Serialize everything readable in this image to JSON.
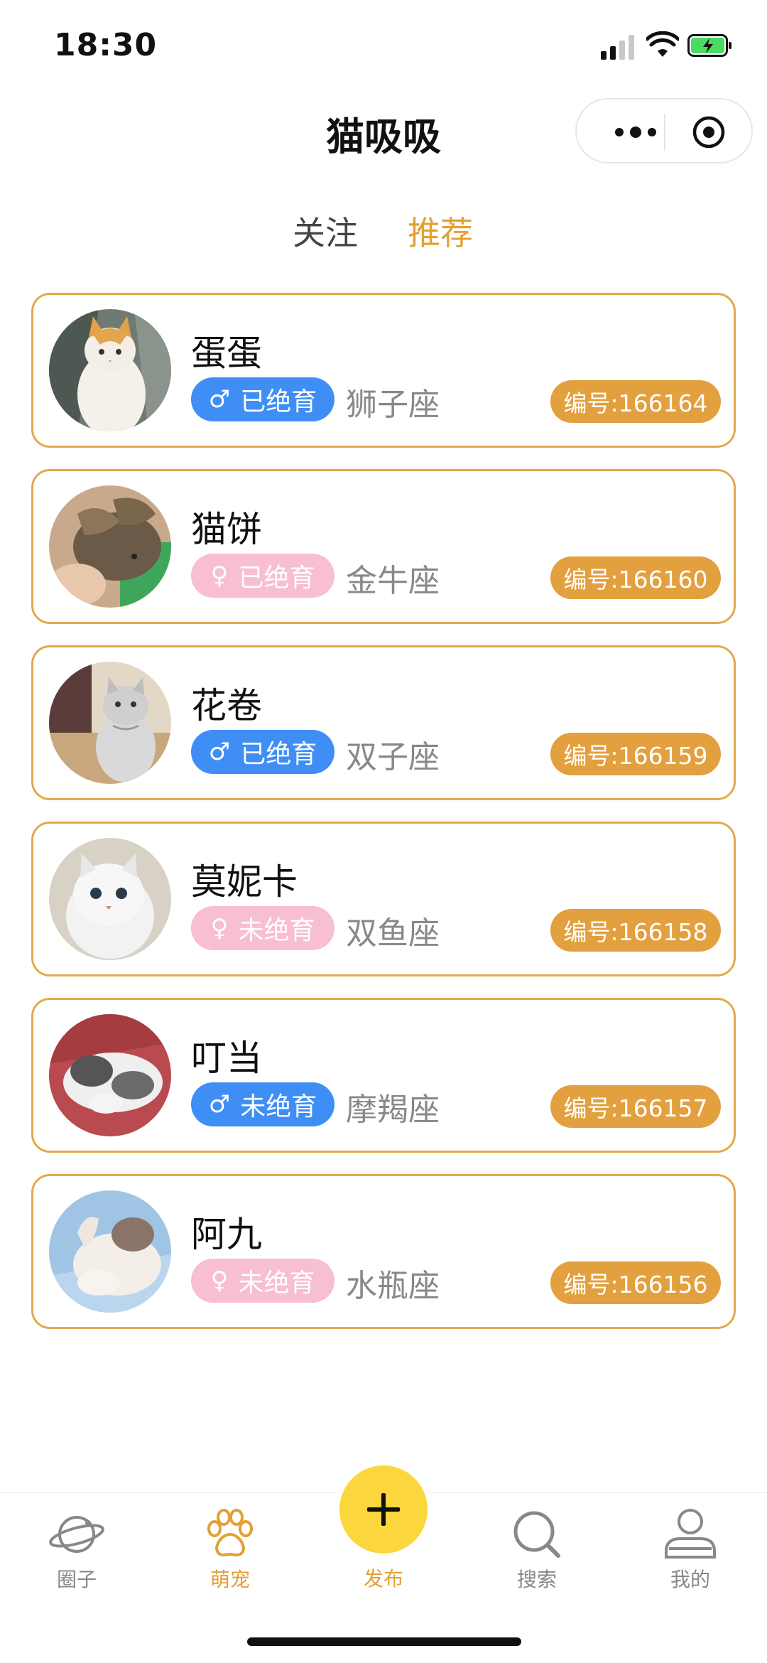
{
  "status": {
    "time": "18:30"
  },
  "header": {
    "title": "猫吸吸"
  },
  "tabs": [
    {
      "label": "关注",
      "active": false
    },
    {
      "label": "推荐",
      "active": true
    }
  ],
  "pets": [
    {
      "name": "蛋蛋",
      "gender": "male",
      "gender_symbol": "♂",
      "status": "已绝育",
      "zodiac": "狮子座",
      "id": "编号:166164"
    },
    {
      "name": "猫饼",
      "gender": "female",
      "gender_symbol": "♀",
      "status": "已绝育",
      "zodiac": "金牛座",
      "id": "编号:166160"
    },
    {
      "name": "花卷",
      "gender": "male",
      "gender_symbol": "♂",
      "status": "已绝育",
      "zodiac": "双子座",
      "id": "编号:166159"
    },
    {
      "name": "莫妮卡",
      "gender": "female",
      "gender_symbol": "♀",
      "status": "未绝育",
      "zodiac": "双鱼座",
      "id": "编号:166158"
    },
    {
      "name": "叮当",
      "gender": "male",
      "gender_symbol": "♂",
      "status": "未绝育",
      "zodiac": "摩羯座",
      "id": "编号:166157"
    },
    {
      "name": "阿九",
      "gender": "female",
      "gender_symbol": "♀",
      "status": "未绝育",
      "zodiac": "水瓶座",
      "id": "编号:166156"
    }
  ],
  "nav": {
    "circle": "圈子",
    "pets": "萌宠",
    "publish": "发布",
    "search": "搜索",
    "mine": "我的"
  },
  "colors": {
    "accent": "#e4a032",
    "card_border": "#e3a94a",
    "male": "#3f8ef5",
    "female": "#f7bfd0",
    "id_badge": "#e3a03e",
    "publish": "#fbd63c"
  }
}
